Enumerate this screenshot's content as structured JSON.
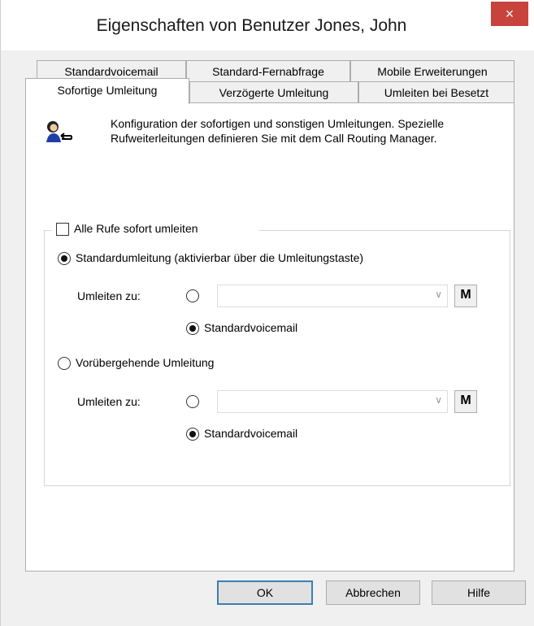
{
  "window": {
    "title": "Eigenschaften von Benutzer Jones, John",
    "close_label": "×"
  },
  "tabs": {
    "row1": [
      "Standardvoicemail",
      "Standard-Fernabfrage",
      "Mobile Erweiterungen"
    ],
    "row2": [
      "Sofortige Umleitung",
      "Verzögerte Umleitung",
      "Umleiten bei Besetzt"
    ]
  },
  "info": {
    "text": "Konfiguration der sofortigen und sonstigen Umleitungen. Spezielle Rufweiterleitungen definieren Sie mit dem Call Routing Manager."
  },
  "group": {
    "checkbox_label": "Alle Rufe sofort umleiten",
    "checkbox_checked": false,
    "standard_label": "Standardumleitung (aktivierbar über die Umleitungstaste)",
    "standard_selected": true,
    "standard_redirect_label": "Umleiten zu:",
    "standard_voicemail_label": "Standardvoicemail",
    "temporary_label": "Vorübergehende Umleitung",
    "temporary_selected": false,
    "temporary_redirect_label": "Umleiten zu:",
    "temporary_voicemail_label": "Standardvoicemail",
    "combo_value": ""
  },
  "buttons": {
    "ok": "OK",
    "cancel": "Abbrechen",
    "help": "Hilfe"
  }
}
